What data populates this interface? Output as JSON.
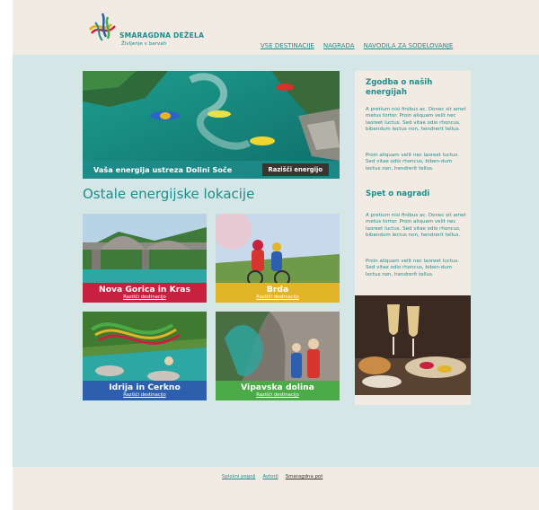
{
  "header": {
    "logo_title": "SMARAGDNA DEŽELA",
    "logo_subtitle": "Življenje v barvah",
    "nav": [
      "VSE DESTINACIJE",
      "NAGRADA",
      "NAVODILA ZA SODELOVANJE"
    ]
  },
  "hero": {
    "caption": "Vaša energija ustreza Dolini Soče",
    "button": "Razišči energijo"
  },
  "section_title": "Ostale energijske lokacije",
  "cards": [
    {
      "title": "Nova Gorica in Kras",
      "link": "Razišči destinacijo",
      "color": "#c8213f"
    },
    {
      "title": "Brda",
      "link": "Razišči destinacijo",
      "color": "#e2b427"
    },
    {
      "title": "Idrija in Cerkno",
      "link": "Razišči destinacijo",
      "color": "#2c5fad"
    },
    {
      "title": "Vipavska dolina",
      "link": "Razišči destinacijo",
      "color": "#4bab47"
    }
  ],
  "sidebar": {
    "heading1": "Zgodba o naših energijah",
    "para1": "A pretium nisi finibus ac. Donec sit amet metus tortor. Proin aliquam velit nec laoreet luctus. Sed vitae odio rhoncus, bibendum lectus non, hendrerit tellus.",
    "para2": "Proin aliquam velit nec laoreet luctus. Sed vitae odio rhoncus, biben-dum lectus non, hendrerit tellus.",
    "heading2": "Spet o nagradi",
    "para3": "A pretium nisi finibus ac. Donec sit amet metus tortor. Proin aliquam velit nec laoreet luctus. Sed vitae odio rhoncus, bibendum lectus non, hendrerit tellus.",
    "para4": "Proin aliquam velit nec laoreet luctus. Sed vitae odio rhoncus, biben-dum lectus non, hendrerit tellus."
  },
  "footer": {
    "links": [
      "Splošni pogoji",
      "Avtorji",
      "Smaragdna pot"
    ]
  },
  "colors": {
    "teal": "#1f8c8b",
    "cream": "#f2ebe3",
    "mint": "#d4e7e6",
    "dark": "#3b3531"
  }
}
